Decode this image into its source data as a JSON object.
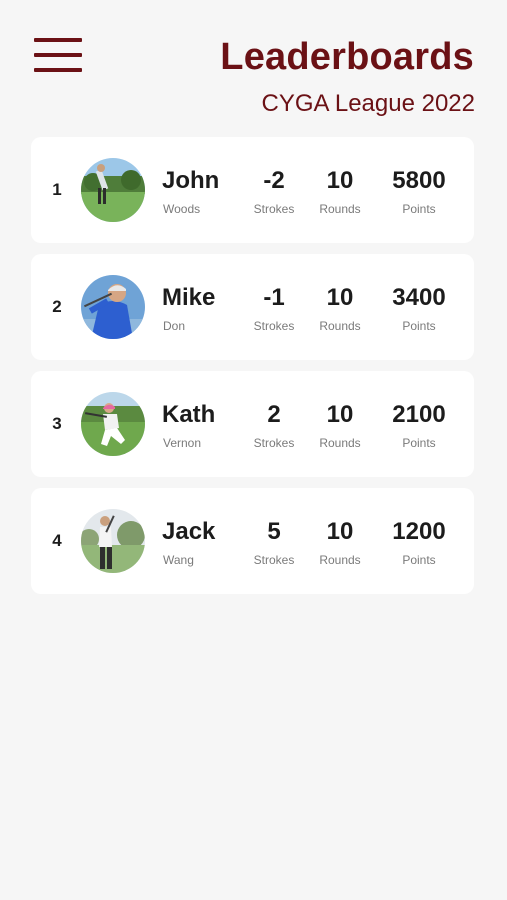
{
  "header": {
    "menu_icon": "hamburger-menu-icon",
    "title": "Leaderboards",
    "subtitle": "CYGA League 2022",
    "accent_color": "#6b1115"
  },
  "leaderboard": {
    "stat_labels": {
      "strokes": "Strokes",
      "rounds": "Rounds",
      "points": "Points"
    },
    "players": [
      {
        "rank": "1",
        "first_name": "John",
        "last_name": "Woods",
        "strokes": "-2",
        "rounds": "10",
        "points": "5800",
        "avatar": "golfer-photo"
      },
      {
        "rank": "2",
        "first_name": "Mike",
        "last_name": "Don",
        "strokes": "-1",
        "rounds": "10",
        "points": "3400",
        "avatar": "golfer-photo"
      },
      {
        "rank": "3",
        "first_name": "Kath",
        "last_name": "Vernon",
        "strokes": "2",
        "rounds": "10",
        "points": "2100",
        "avatar": "golfer-photo"
      },
      {
        "rank": "4",
        "first_name": "Jack",
        "last_name": "Wang",
        "strokes": "5",
        "rounds": "10",
        "points": "1200",
        "avatar": "golfer-photo"
      }
    ]
  }
}
